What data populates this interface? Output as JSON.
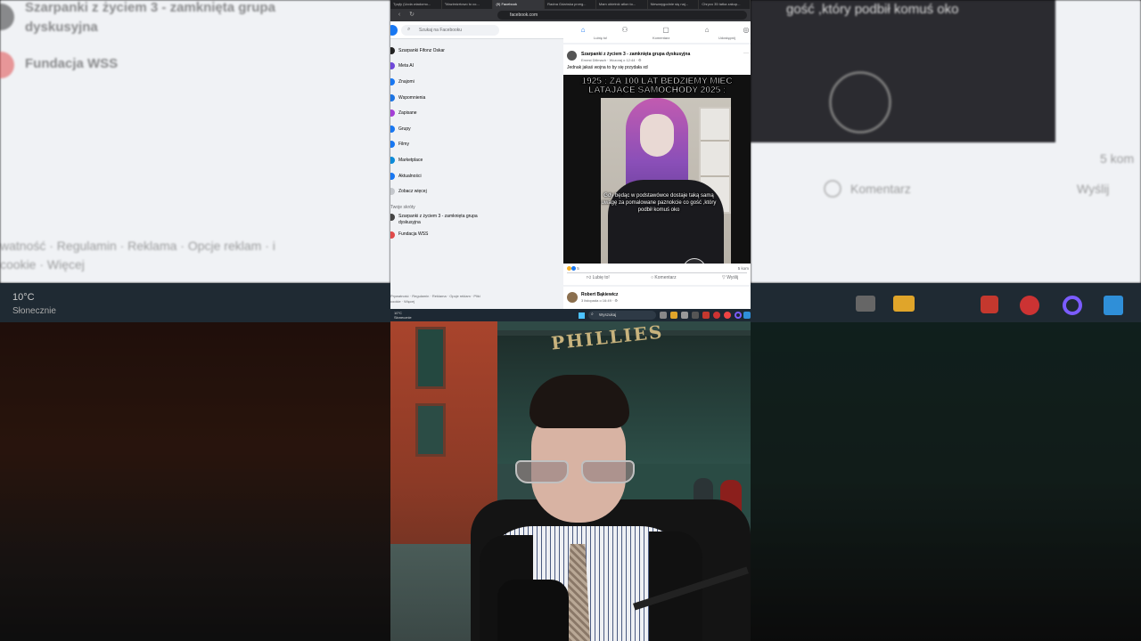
{
  "browser": {
    "tabs": [
      "Tpqfy (Ucda wiadomo...",
      "\"Mazimizrtowo to co...",
      "(9) Facebook",
      "Radna Gdańska przeg...",
      "Mam obietnić atlon to...",
      "Niewarygodnie się naj...",
      "Chryzo 35 tatka zakup..."
    ],
    "active_tab": "(9) Facebook",
    "url": "facebook.com"
  },
  "facebook": {
    "search_placeholder": "Szukaj na Facebooku",
    "nav_items": [
      {
        "label": "Szarpanki Fifonz Oskar",
        "color": "#222"
      },
      {
        "label": "Meta AI",
        "color": "#6f48d9"
      },
      {
        "label": "Znajomi",
        "color": "#1877f2"
      },
      {
        "label": "Wspomnienia",
        "color": "#1b74e4"
      },
      {
        "label": "Zapisane",
        "color": "#a53fd6"
      },
      {
        "label": "Grupy",
        "color": "#1877f2"
      },
      {
        "label": "Filmy",
        "color": "#1877f2"
      },
      {
        "label": "Marketplace",
        "color": "#0c8bd9"
      },
      {
        "label": "Aktualności",
        "color": "#1877f2"
      },
      {
        "label": "Zobacz więcej",
        "color": "#c4c7cc"
      }
    ],
    "shortcuts_heading": "Twoje skróty",
    "shortcuts": [
      "Szarpanki z życiem 3 - zamknięta grupa dyskusyjna",
      "Fundacja WSS"
    ],
    "footer": "Prywatność · Regulamin · Reklama · Opcje reklam · Pliki cookie · Więcej",
    "top_actions": [
      "Lubię to!",
      "Komentarz",
      "Udostępnij"
    ],
    "post": {
      "group": "Szarpanki z życiem 3 - zamknięta grupa dyskusyjna",
      "author_time": "Ernest Dillmach · Wczoraj o 12:44 · ⚙",
      "caption": "Jednak jakaś wojna to by się przydała xd",
      "meme_title": "1925 : ZA 100 LAT BĘDZIEMY MIEĆ LATAJĄCE SAMOCHODY 2025 :",
      "meme_subtitle": "Gdy będąc w podstawówce dostaje taką samą uwagę za pomalowane paznokcie co gość ,który podbił komuś oko",
      "reaction_count": "5",
      "comment_count": "5 kom",
      "like_label": "Lubię to!",
      "comment_label": "Komentarz",
      "share_label": "Wyślij"
    },
    "next_post": {
      "author": "Robert Bąkiewicz",
      "meta": "3 listopada o 16:49 · ⚙"
    }
  },
  "taskbar": {
    "temperature": "10°C",
    "condition": "Słonecznie",
    "search": "Wyszukaj"
  },
  "webcam": {
    "sign": "PHILLIES"
  },
  "blurred_left": {
    "group": "Szarpanki z życiem 3 - zamknięta grupa dyskusyjna",
    "fundacja": "Fundacja WSS",
    "footer": "watność · Regulamin · Reklama · Opcje reklam · i cookie · Więcej",
    "temp": "10°C",
    "cond": "Słonecznie"
  },
  "blurred_right": {
    "subtitle": "gość ,który podbił komuś oko",
    "comments": "5 kom",
    "comment_btn": "Komentarz",
    "share_btn": "Wyślij"
  },
  "colors": {
    "fb_blue": "#1877f2",
    "fb_bg": "#f0f2f5",
    "taskbar": "#1d2833"
  }
}
